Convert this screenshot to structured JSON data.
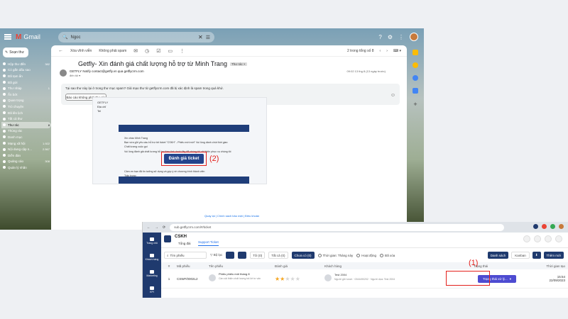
{
  "gmail": {
    "logo": "Gmail",
    "search_value": "Ngoc",
    "compose": "Soạn thư",
    "sidebar": [
      {
        "label": "Hộp thư đến",
        "count": "382"
      },
      {
        "label": "Có gắn dấu sao",
        "count": ""
      },
      {
        "label": "Đã tạm ẩn",
        "count": ""
      },
      {
        "label": "Đã gửi",
        "count": ""
      },
      {
        "label": "Thư nháp",
        "count": "1"
      },
      {
        "label": "Ẩn bớt",
        "count": ""
      },
      {
        "label": "Quan trọng",
        "count": ""
      },
      {
        "label": "Trò chuyện",
        "count": ""
      },
      {
        "label": "Đã lên lịch",
        "count": ""
      },
      {
        "label": "Tất cả thư",
        "count": ""
      },
      {
        "label": "Thư rác",
        "count": "8",
        "active": true
      },
      {
        "label": "Thùng rác",
        "count": ""
      },
      {
        "label": "Danh mục",
        "count": ""
      },
      {
        "label": "Mạng xã hội",
        "count": "1.922"
      },
      {
        "label": "Nội dung cập n...",
        "count": "2.567"
      },
      {
        "label": "Diễn đàn",
        "count": ""
      },
      {
        "label": "Quảng cáo",
        "count": "308"
      },
      {
        "label": "Quản lý nhãn",
        "count": ""
      }
    ],
    "toolbar": {
      "delete_forever": "Xóa vĩnh viễn",
      "not_spam": "Không phải spam",
      "paging": "2 trong tổng số 8"
    },
    "subject": "Getfly- Xin đánh giá chất lượng hỗ trợ từ Minh Trang",
    "subject_label": "Thư rác ×",
    "sender_line": "GETFLY Notify contact@getfly.vn qua getflycrm.com",
    "to_line": "đến tôi ▾",
    "date": "09:02 13 thg 8 (13 ngày trước)",
    "spam_notice": "Tại sao thư này lại ở trong thư mục spam? Giả mạo thư từ getflycrm.com đã bị xác định là spam trong quá khứ.",
    "spam_button": "Báo cáo không phải thư rác",
    "mail_header": [
      "GETFLY",
      "Địa chỉ",
      "Tel"
    ],
    "mail_body": [
      "Xin chào Minh Trang",
      "Bạn vừa gửi yêu cầu hỗ trợ tới ticket \"CSKH\" - Phiếu mới mới\" Vui lòng dành chút thời gian",
      "Chất lượng cuộc gọi",
      "Vui lòng đánh giá chất lượng hỗ trợ theo link dưới đây để chúng tôi cải thiện phục vụ chúng tôi"
    ],
    "rate_button": "Đánh giá ticket",
    "mail_body2": [
      "Cảm ơn bạn đã tin tưởng sử dụng và góp ý về chương trình thành viên",
      "Trân trọng"
    ],
    "mail_footer": "Quay lại | Chính sách bảo mật | Điều khoản",
    "marker": "(2)"
  },
  "getfly": {
    "url": "sub.getflycrm.com/#/ticket",
    "nav": [
      "Trang chủ",
      "Khách hàng",
      "Marketing",
      "KPI",
      "Bán hàng"
    ],
    "title": "CSKH",
    "tabs": [
      "Tổng đài",
      "Support Ticket"
    ],
    "filter": {
      "search_placeholder": "Tìm phiếu",
      "filter_label": "Bộ lọc",
      "tab_all": "Tôi (0)",
      "tab_all2": "Tất cả (0)",
      "tab_active": "Chưa có (0)",
      "time_filter": "Thời gian: Tháng này",
      "active": "Hoạt động",
      "deleted": "Đã xóa",
      "view_list": "Danh sách",
      "view_kanban": "Kanban",
      "add_new": "Thêm mới"
    },
    "table": {
      "headers": [
        "#",
        "Mã phiếu",
        "Tên phiếu",
        "Đánh giá",
        "Khách hàng",
        "Trạng thái",
        "Thời gian tạo"
      ],
      "rows": [
        {
          "idx": "1",
          "code": "CSWF/0002L2",
          "ticket_title": "Phiếu phiếu mới tháng 8",
          "ticket_sub": "Cần cải thiện chất lượng trả lời tư vấn",
          "rating": 2,
          "customer": "Test 2004",
          "customer_meta": "Người gửi lunch · 0344490202 · Người dựa: Test 2004",
          "status": "Trạng thái xử lý...",
          "time": "15:54 22/09/2023"
        }
      ]
    },
    "marker": "(1)"
  },
  "colors": {
    "accent": "#1f3a6e",
    "status": "#4d4bd1",
    "highlight": "#e3201b",
    "star": "#f5a623"
  }
}
